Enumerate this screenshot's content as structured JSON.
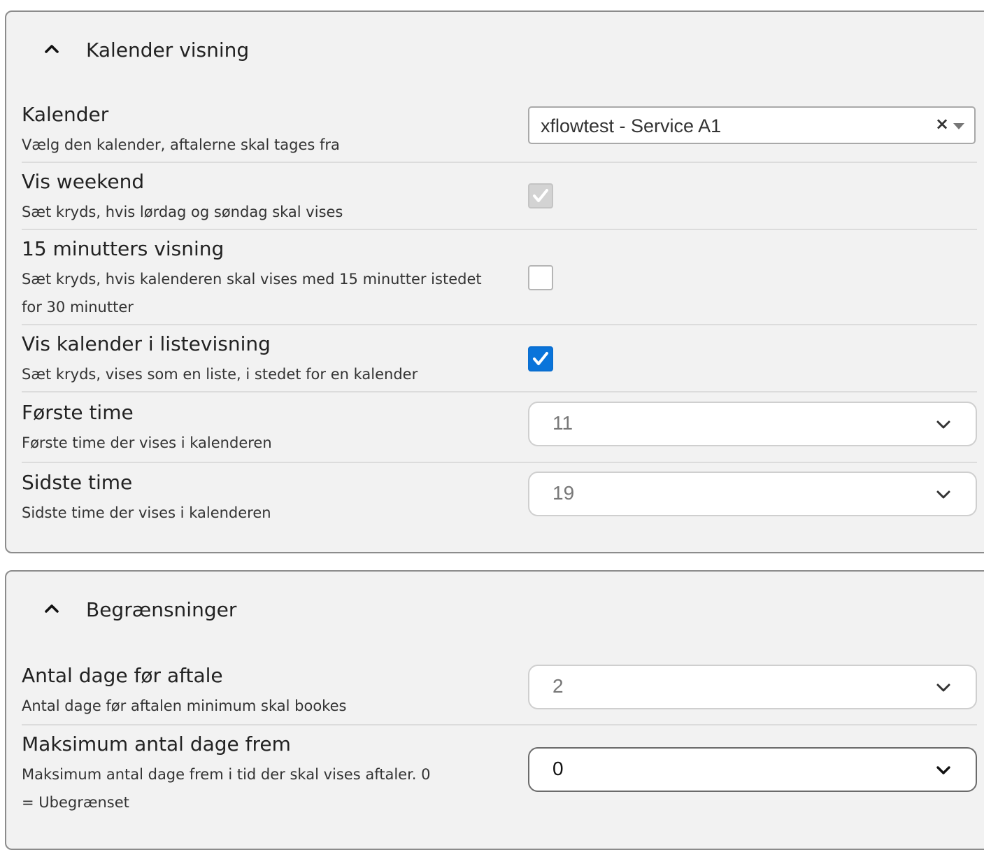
{
  "panels": [
    {
      "title": "Kalender visning",
      "rows": [
        {
          "title": "Kalender",
          "description": "Vælg den kalender, aftalerne skal tages fra",
          "value": "xflowtest - Service A1",
          "clear_symbol": "×"
        },
        {
          "title": "Vis weekend",
          "description": "Sæt kryds, hvis lørdag og søndag skal vises",
          "state": "checked-disabled"
        },
        {
          "title": "15 minutters visning",
          "description": "Sæt kryds, hvis kalenderen skal vises med 15 minutter istedet for 30 minutter",
          "state": "unchecked"
        },
        {
          "title": "Vis kalender i listevisning",
          "description": "Sæt kryds, vises som en liste, i stedet for en kalender",
          "state": "checked"
        },
        {
          "title": "Første time",
          "description": "Første time der vises i kalenderen",
          "value": "11"
        },
        {
          "title": "Sidste time",
          "description": "Sidste time der vises i kalenderen",
          "value": "19"
        }
      ]
    },
    {
      "title": "Begrænsninger",
      "rows": [
        {
          "title": "Antal dage før aftale",
          "description": "Antal dage før aftalen minimum skal bookes",
          "value": "2"
        },
        {
          "title": "Maksimum antal dage frem",
          "description": "Maksimum antal dage frem i tid der skal vises aftaler. 0 = Ubegrænset",
          "value": "0"
        }
      ]
    }
  ],
  "colors": {
    "checkbox_checked": "#0a74da",
    "panel_background": "#f2f2f2"
  },
  "icons": {
    "collapse": "chevron-up-icon",
    "dropdown": "chevron-down-icon",
    "check": "check-icon"
  }
}
